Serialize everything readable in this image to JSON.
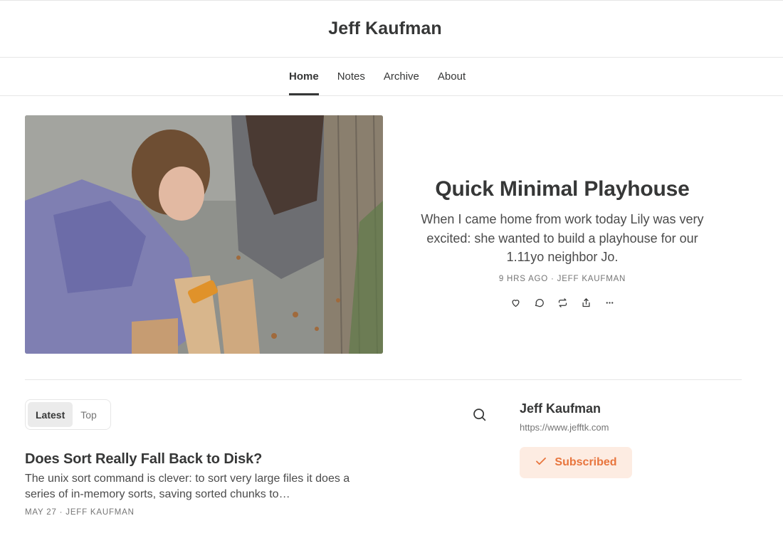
{
  "site": {
    "title": "Jeff Kaufman"
  },
  "nav": {
    "tabs": [
      {
        "label": "Home",
        "active": true
      },
      {
        "label": "Notes",
        "active": false
      },
      {
        "label": "Archive",
        "active": false
      },
      {
        "label": "About",
        "active": false
      }
    ]
  },
  "featured": {
    "title": "Quick Minimal Playhouse",
    "subtitle": "When I came home from work today Lily was very excited: she wanted to build a playhouse for our 1.11yo neighbor Jo.",
    "meta": "9 HRS AGO · JEFF KAUFMAN",
    "actions": [
      "heart-icon",
      "comment-icon",
      "restack-icon",
      "share-icon",
      "more-icon"
    ]
  },
  "feed": {
    "sort_options": [
      {
        "label": "Latest",
        "active": true
      },
      {
        "label": "Top",
        "active": false
      }
    ],
    "posts": [
      {
        "title": "Does Sort Really Fall Back to Disk?",
        "excerpt": "The unix sort command is clever: to sort very large files it does a series of in-memory sorts, saving sorted chunks to…",
        "meta": "MAY 27 · JEFF KAUFMAN"
      }
    ]
  },
  "sidebar": {
    "name": "Jeff Kaufman",
    "url": "https://www.jefftk.com",
    "subscribe_label": "Subscribed"
  },
  "colors": {
    "text": "#363737",
    "muted": "#757575",
    "accent": "#e8753d",
    "accent_bg": "#fdece2",
    "border": "#e6e6e6"
  }
}
